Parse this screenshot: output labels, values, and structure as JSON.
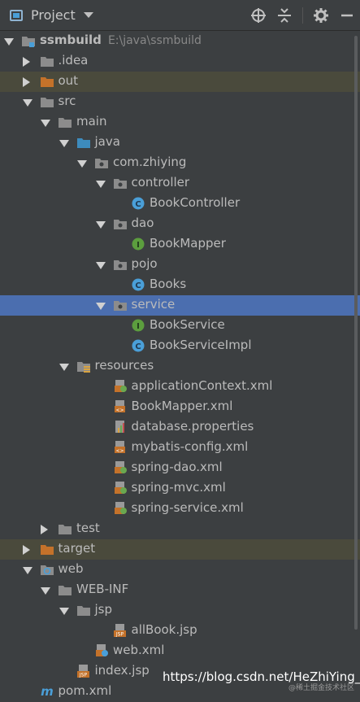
{
  "header": {
    "title": "Project",
    "icons": [
      "project-icon",
      "dropdown-icon",
      "locate-icon",
      "collapse-icon",
      "gear-icon",
      "hide-icon"
    ]
  },
  "tree": [
    {
      "label": "ssmbuild",
      "path": "E:\\java\\ssmbuild",
      "level": 0,
      "arrow": "down",
      "icon": "module",
      "bold": true
    },
    {
      "label": ".idea",
      "level": 1,
      "arrow": "right",
      "icon": "folder-gray"
    },
    {
      "label": "out",
      "level": 1,
      "arrow": "right",
      "icon": "folder-orange",
      "state": "dim"
    },
    {
      "label": "src",
      "level": 1,
      "arrow": "down",
      "icon": "folder-gray"
    },
    {
      "label": "main",
      "level": 2,
      "arrow": "down",
      "icon": "folder-gray"
    },
    {
      "label": "java",
      "level": 3,
      "arrow": "down",
      "icon": "folder-blue"
    },
    {
      "label": "com.zhiying",
      "level": 4,
      "arrow": "down",
      "icon": "package"
    },
    {
      "label": "controller",
      "level": 5,
      "arrow": "down",
      "icon": "package"
    },
    {
      "label": "BookController",
      "level": 6,
      "icon": "class"
    },
    {
      "label": "dao",
      "level": 5,
      "arrow": "down",
      "icon": "package"
    },
    {
      "label": "BookMapper",
      "level": 6,
      "icon": "interface"
    },
    {
      "label": "pojo",
      "level": 5,
      "arrow": "down",
      "icon": "package"
    },
    {
      "label": "Books",
      "level": 6,
      "icon": "class"
    },
    {
      "label": "service",
      "level": 5,
      "arrow": "down",
      "icon": "package",
      "state": "sel"
    },
    {
      "label": "BookService",
      "level": 6,
      "icon": "interface"
    },
    {
      "label": "BookServiceImpl",
      "level": 6,
      "icon": "class"
    },
    {
      "label": "resources",
      "level": 3,
      "arrow": "down",
      "icon": "folder-res"
    },
    {
      "label": "applicationContext.xml",
      "level": 5,
      "icon": "xml-spring"
    },
    {
      "label": "BookMapper.xml",
      "level": 5,
      "icon": "xml"
    },
    {
      "label": "database.properties",
      "level": 5,
      "icon": "properties"
    },
    {
      "label": "mybatis-config.xml",
      "level": 5,
      "icon": "xml"
    },
    {
      "label": "spring-dao.xml",
      "level": 5,
      "icon": "xml-spring"
    },
    {
      "label": "spring-mvc.xml",
      "level": 5,
      "icon": "xml-spring"
    },
    {
      "label": "spring-service.xml",
      "level": 5,
      "icon": "xml-spring"
    },
    {
      "label": "test",
      "level": 2,
      "arrow": "right",
      "icon": "folder-gray"
    },
    {
      "label": "target",
      "level": 1,
      "arrow": "right",
      "icon": "folder-orange",
      "state": "dim"
    },
    {
      "label": "web",
      "level": 1,
      "arrow": "down",
      "icon": "folder-web"
    },
    {
      "label": "WEB-INF",
      "level": 2,
      "arrow": "down",
      "icon": "folder-gray"
    },
    {
      "label": "jsp",
      "level": 3,
      "arrow": "down",
      "icon": "folder-gray"
    },
    {
      "label": "allBook.jsp",
      "level": 5,
      "icon": "jsp"
    },
    {
      "label": "web.xml",
      "level": 4,
      "icon": "xml-web"
    },
    {
      "label": "index.jsp",
      "level": 3,
      "icon": "jsp"
    },
    {
      "label": "pom.xml",
      "level": 1,
      "icon": "maven"
    }
  ],
  "watermark": "https://blog.csdn.net/HeZhiYing_",
  "watermark_small": "@稀土掘金技术社区",
  "colors": {
    "background": "#3c3f41",
    "selection": "#4b6eaf",
    "excluded_row": "#4a4a3c",
    "folder_orange": "#c4722a",
    "folder_blue": "#3d8bbd",
    "class_blue": "#4a9fd8",
    "interface_green": "#5c9e3e"
  }
}
